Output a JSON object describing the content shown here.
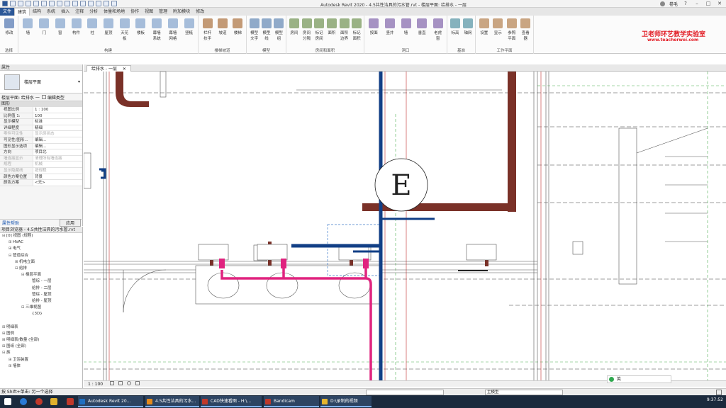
{
  "window": {
    "title": "Autodesk Revit 2020 - 4.5共性洁具的污水管.rvt - 楼层平面: 给排水 - 一层",
    "user": "卷毛"
  },
  "ribbon_tabs": [
    "文件",
    "建筑",
    "结构",
    "系统",
    "插入",
    "注释",
    "分析",
    "体量和场地",
    "协作",
    "视图",
    "管理",
    "附加模块",
    "修改"
  ],
  "ribbon": {
    "groups": [
      {
        "label": "选择",
        "buttons": [
          "修改"
        ]
      },
      {
        "label": "构建",
        "buttons": [
          "墙",
          "门",
          "窗",
          "构件",
          "柱",
          "屋顶",
          "天花板",
          "楼板",
          "幕墙系统",
          "幕墙网格",
          "竖梃"
        ]
      },
      {
        "label": "楼梯坡道",
        "buttons": [
          "栏杆扶手",
          "坡道",
          "楼梯"
        ]
      },
      {
        "label": "模型",
        "buttons": [
          "模型文字",
          "模型线",
          "模型组"
        ]
      },
      {
        "label": "房间和面积",
        "buttons": [
          "房间",
          "房间分隔",
          "标记房间",
          "面积",
          "面积边界",
          "标记面积"
        ]
      },
      {
        "label": "洞口",
        "buttons": [
          "按面",
          "竖井",
          "墙",
          "垂直",
          "老虎窗"
        ]
      },
      {
        "label": "基准",
        "buttons": [
          "标高",
          "轴网"
        ]
      },
      {
        "label": "工作平面",
        "buttons": [
          "设置",
          "显示",
          "参照平面",
          "查看器"
        ]
      }
    ],
    "brand_cn": "卫老师环艺教学实验室",
    "brand_url": "www.teacherwei.com"
  },
  "properties": {
    "title": "属性",
    "type_name": "楼层平面",
    "view_selector": "楼层平面: 给排水 一",
    "edit_type": "编辑类型",
    "section": "图形",
    "rows": [
      {
        "k": "视图比例",
        "v": "1 : 100",
        "dim": false
      },
      {
        "k": "比例值 1:",
        "v": "100",
        "dim": false
      },
      {
        "k": "显示模型",
        "v": "标准",
        "dim": false
      },
      {
        "k": "详细程度",
        "v": "精细",
        "dim": false
      },
      {
        "k": "零件可见性",
        "v": "显示原状态",
        "dim": true
      },
      {
        "k": "可见性/图形...",
        "v": "编辑...",
        "dim": false
      },
      {
        "k": "图形显示选项",
        "v": "编辑...",
        "dim": false
      },
      {
        "k": "方向",
        "v": "项目北",
        "dim": false
      },
      {
        "k": "墙连接显示",
        "v": "清理所有墙连接",
        "dim": true
      },
      {
        "k": "规程",
        "v": "机械",
        "dim": true
      },
      {
        "k": "显示隐藏线",
        "v": "按规程",
        "dim": true
      },
      {
        "k": "颜色方案位置",
        "v": "背景",
        "dim": false
      },
      {
        "k": "颜色方案",
        "v": "<无>",
        "dim": false
      }
    ],
    "help_link": "属性帮助",
    "apply": "应用"
  },
  "browser": {
    "title": "项目浏览器 - 4.5共性洁具的污水管.rvt",
    "items": [
      {
        "indent": 0,
        "toggle": "⊟",
        "label": "[0] 视图 (规程)"
      },
      {
        "indent": 1,
        "toggle": "⊞",
        "label": "HVAC"
      },
      {
        "indent": 1,
        "toggle": "⊞",
        "label": "电气"
      },
      {
        "indent": 1,
        "toggle": "⊟",
        "label": "管道综合"
      },
      {
        "indent": 2,
        "toggle": "⊞",
        "label": "机电立面"
      },
      {
        "indent": 2,
        "toggle": "⊟",
        "label": "给排"
      },
      {
        "indent": 3,
        "toggle": "⊟",
        "label": "楼层平面"
      },
      {
        "indent": 4,
        "toggle": "",
        "label": "管综 - 一层"
      },
      {
        "indent": 4,
        "toggle": "",
        "label": "给排 - 二层"
      },
      {
        "indent": 4,
        "toggle": "",
        "label": "管综 - 屋顶"
      },
      {
        "indent": 4,
        "toggle": "",
        "label": "给排 - 屋顶"
      },
      {
        "indent": 3,
        "toggle": "⊟",
        "label": "三维视图"
      },
      {
        "indent": 4,
        "toggle": "",
        "label": "{3D}"
      },
      {
        "indent": 0,
        "toggle": "",
        "label": ""
      },
      {
        "indent": 0,
        "toggle": "⊞",
        "label": "明细表"
      },
      {
        "indent": 0,
        "toggle": "⊞",
        "label": "图例"
      },
      {
        "indent": 0,
        "toggle": "⊞",
        "label": "明细表/数量 (全部)"
      },
      {
        "indent": 0,
        "toggle": "⊞",
        "label": "图纸 (全部)"
      },
      {
        "indent": 0,
        "toggle": "⊟",
        "label": "族"
      },
      {
        "indent": 1,
        "toggle": "⊞",
        "label": "卫浴装置"
      },
      {
        "indent": 1,
        "toggle": "⊞",
        "label": "墙体"
      }
    ]
  },
  "view_tab": "给排水 - 一层",
  "grid_bubble": "E",
  "view_bar": {
    "scale": "1 : 100"
  },
  "status": {
    "message": "按 Shift+单击: 另一个选择",
    "model_box": "主模型",
    "ime": "英"
  },
  "taskbar": {
    "tasks": [
      {
        "label": "Autodesk Revit 20...",
        "color": "#1f6fc1"
      },
      {
        "label": "4.5共性洁具的污水...",
        "color": "#e58a1c"
      },
      {
        "label": "CAD快速看图 - H:\\...",
        "color": "#c0392b"
      },
      {
        "label": "Bandicam",
        "color": "#c0392b"
      },
      {
        "label": "D:\\录制的视频",
        "color": "#e6b52e"
      }
    ],
    "clock": "9:37:52"
  },
  "colors": {
    "wall_brown": "#7a3128",
    "pipe_blue": "#123f86",
    "pipe_magenta": "#e0237f",
    "gridline_red": "#c84a4a",
    "ribbon_accent": "#2b5797"
  }
}
